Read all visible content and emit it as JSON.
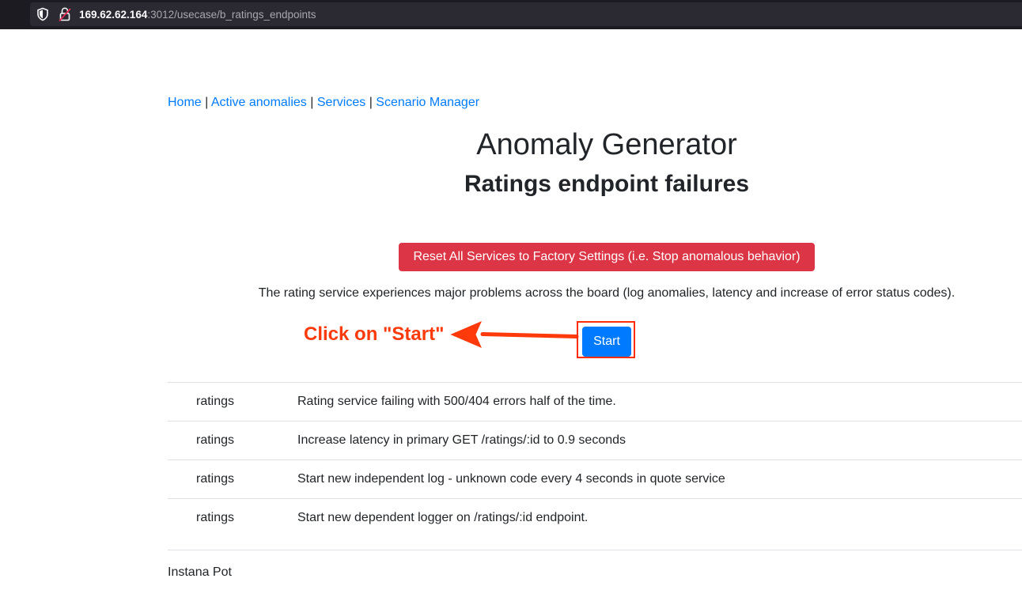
{
  "browser": {
    "url_host": "169.62.62.164",
    "url_rest": ":3012/usecase/b_ratings_endpoints"
  },
  "nav": {
    "links": [
      "Home",
      "Active anomalies",
      "Services",
      "Scenario Manager"
    ],
    "separator": "|"
  },
  "page": {
    "title": "Anomaly Generator",
    "subtitle": "Ratings endpoint failures",
    "reset_label": "Reset All Services to Factory Settings (i.e. Stop anomalous behavior)",
    "description": "The rating service experiences major problems across the board (log anomalies, latency and increase of error status codes).",
    "start_label": "Start"
  },
  "annotation": {
    "text": "Click on \"Start\"",
    "color": "#ff3a0a"
  },
  "anomalies": [
    {
      "service": "ratings",
      "description": "Rating service failing with 500/404 errors half of the time."
    },
    {
      "service": "ratings",
      "description": "Increase latency in primary GET /ratings/:id to 0.9 seconds"
    },
    {
      "service": "ratings",
      "description": "Start new independent log - unknown code every 4 seconds in quote service"
    },
    {
      "service": "ratings",
      "description": "Start new dependent logger on /ratings/:id endpoint."
    }
  ],
  "footer": {
    "text": "Instana Pot"
  },
  "colors": {
    "link": "#007bff",
    "danger": "#dc3545",
    "primary": "#007bff"
  }
}
